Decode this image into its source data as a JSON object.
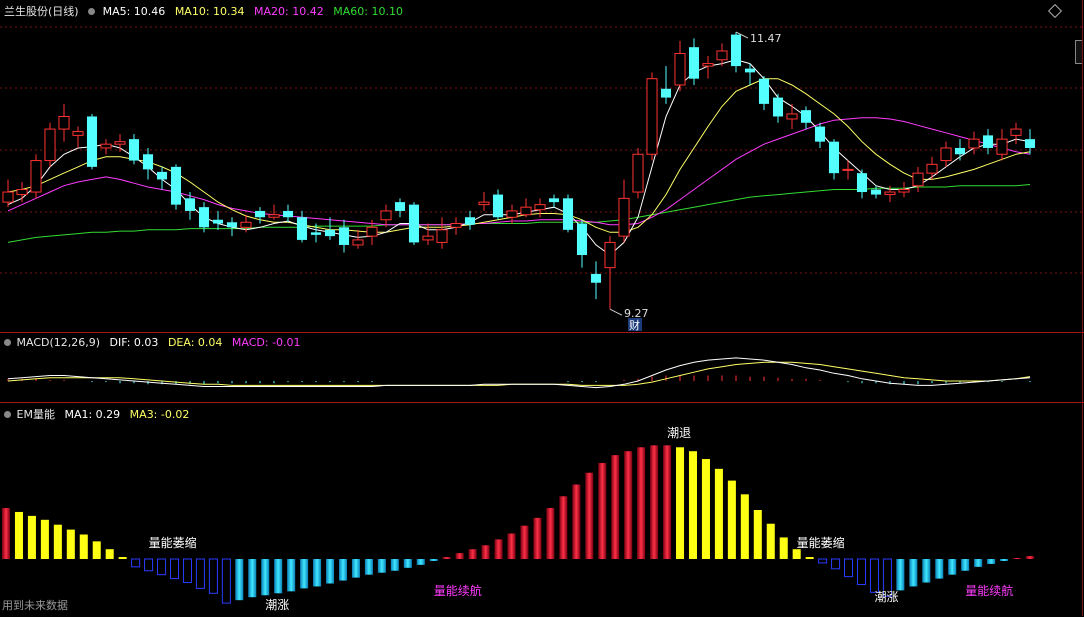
{
  "main": {
    "stock_name": "兰生股份(日线)",
    "ma5": "MA5: 10.46",
    "ma10": "MA10: 10.34",
    "ma20": "MA20: 10.42",
    "ma60": "MA60: 10.10",
    "high_label": "11.47",
    "low_label": "9.27",
    "fin_badge": "财"
  },
  "macd": {
    "title": "MACD(12,26,9)",
    "dif": "DIF: 0.03",
    "dea": "DEA: 0.04",
    "macd": "MACD: -0.01"
  },
  "em": {
    "title": "EM量能",
    "ma1": "MA1: 0.29",
    "ma3": "MA3: -0.02",
    "labels": {
      "shrink1": "量能萎缩",
      "rise1": "潮涨",
      "continue1": "量能续航",
      "retreat": "潮退",
      "shrink2": "量能萎缩",
      "rise2": "潮涨",
      "continue2": "量能续航"
    }
  },
  "footer": "用到未来数据",
  "colors": {
    "up": "#ff3232",
    "down": "#54ffff",
    "ma5": "#ffffff",
    "ma10": "#ffff66",
    "ma20": "#ff3cff",
    "ma60": "#32dc32",
    "dea": "#ffff66"
  },
  "chart_data": {
    "type": "candlestick",
    "candles": [
      [
        10.12,
        10.2,
        10.3,
        10.08
      ],
      [
        10.18,
        10.22,
        10.28,
        10.12
      ],
      [
        10.2,
        10.45,
        10.5,
        10.15
      ],
      [
        10.45,
        10.7,
        10.75,
        10.4
      ],
      [
        10.7,
        10.8,
        10.9,
        10.6
      ],
      [
        10.65,
        10.68,
        10.72,
        10.55
      ],
      [
        10.8,
        10.4,
        10.82,
        10.38
      ],
      [
        10.55,
        10.58,
        10.62,
        10.5
      ],
      [
        10.58,
        10.6,
        10.66,
        10.52
      ],
      [
        10.62,
        10.45,
        10.66,
        10.42
      ],
      [
        10.5,
        10.38,
        10.55,
        10.3
      ],
      [
        10.36,
        10.3,
        10.4,
        10.22
      ],
      [
        10.4,
        10.1,
        10.42,
        10.06
      ],
      [
        10.15,
        10.05,
        10.2,
        9.98
      ],
      [
        10.08,
        9.92,
        10.12,
        9.88
      ],
      [
        9.98,
        9.95,
        10.05,
        9.9
      ],
      [
        9.96,
        9.92,
        10.0,
        9.85
      ],
      [
        9.92,
        9.96,
        10.02,
        9.88
      ],
      [
        10.05,
        10.0,
        10.08,
        9.95
      ],
      [
        10.0,
        10.02,
        10.1,
        9.98
      ],
      [
        10.05,
        10.0,
        10.1,
        9.96
      ],
      [
        10.0,
        9.82,
        10.05,
        9.8
      ],
      [
        9.88,
        9.86,
        9.95,
        9.8
      ],
      [
        9.9,
        9.85,
        10.0,
        9.82
      ],
      [
        9.92,
        9.78,
        9.98,
        9.72
      ],
      [
        9.78,
        9.82,
        9.9,
        9.75
      ],
      [
        9.85,
        9.92,
        9.98,
        9.78
      ],
      [
        9.98,
        10.05,
        10.1,
        9.92
      ],
      [
        10.12,
        10.05,
        10.15,
        10.0
      ],
      [
        10.1,
        9.8,
        10.12,
        9.78
      ],
      [
        9.82,
        9.85,
        9.95,
        9.78
      ],
      [
        9.8,
        9.9,
        10.0,
        9.75
      ],
      [
        9.92,
        9.95,
        10.0,
        9.86
      ],
      [
        10.0,
        9.94,
        10.05,
        9.9
      ],
      [
        10.1,
        10.12,
        10.2,
        10.05
      ],
      [
        10.18,
        10.0,
        10.22,
        9.98
      ],
      [
        10.0,
        10.05,
        10.1,
        9.95
      ],
      [
        10.02,
        10.08,
        10.15,
        10.0
      ],
      [
        10.06,
        10.1,
        10.15,
        10.0
      ],
      [
        10.15,
        10.12,
        10.18,
        10.08
      ],
      [
        10.15,
        9.9,
        10.18,
        9.88
      ],
      [
        9.95,
        9.7,
        9.98,
        9.6
      ],
      [
        9.55,
        9.48,
        9.65,
        9.35
      ],
      [
        9.6,
        9.8,
        9.85,
        9.27
      ],
      [
        9.85,
        10.15,
        10.3,
        9.8
      ],
      [
        10.2,
        10.5,
        10.55,
        10.15
      ],
      [
        10.5,
        11.1,
        11.15,
        10.45
      ],
      [
        11.02,
        10.95,
        11.2,
        10.9
      ],
      [
        11.05,
        11.3,
        11.4,
        11.0
      ],
      [
        11.35,
        11.1,
        11.42,
        11.05
      ],
      [
        11.2,
        11.22,
        11.28,
        11.1
      ],
      [
        11.25,
        11.32,
        11.38,
        11.2
      ],
      [
        11.45,
        11.2,
        11.47,
        11.15
      ],
      [
        11.18,
        11.15,
        11.22,
        11.05
      ],
      [
        11.1,
        10.9,
        11.12,
        10.85
      ],
      [
        10.95,
        10.8,
        10.98,
        10.75
      ],
      [
        10.78,
        10.82,
        10.9,
        10.7
      ],
      [
        10.85,
        10.75,
        10.88,
        10.7
      ],
      [
        10.72,
        10.6,
        10.75,
        10.55
      ],
      [
        10.6,
        10.35,
        10.62,
        10.3
      ],
      [
        10.38,
        10.38,
        10.45,
        10.3
      ],
      [
        10.35,
        10.2,
        10.38,
        10.15
      ],
      [
        10.22,
        10.18,
        10.25,
        10.15
      ],
      [
        10.18,
        10.2,
        10.25,
        10.12
      ],
      [
        10.2,
        10.22,
        10.28,
        10.16
      ],
      [
        10.25,
        10.35,
        10.4,
        10.2
      ],
      [
        10.35,
        10.42,
        10.48,
        10.3
      ],
      [
        10.45,
        10.55,
        10.6,
        10.4
      ],
      [
        10.55,
        10.5,
        10.62,
        10.45
      ],
      [
        10.55,
        10.62,
        10.68,
        10.5
      ],
      [
        10.65,
        10.55,
        10.7,
        10.5
      ],
      [
        10.5,
        10.62,
        10.7,
        10.45
      ],
      [
        10.65,
        10.7,
        10.75,
        10.58
      ],
      [
        10.62,
        10.55,
        10.7,
        10.5
      ]
    ],
    "ma5": [
      10.1,
      10.15,
      10.25,
      10.4,
      10.5,
      10.55,
      10.56,
      10.58,
      10.55,
      10.48,
      10.4,
      10.3,
      10.22,
      10.1,
      10.0,
      9.95,
      9.92,
      9.9,
      9.92,
      9.95,
      9.97,
      9.93,
      9.9,
      9.88,
      9.86,
      9.84,
      9.85,
      9.88,
      9.95,
      9.95,
      9.9,
      9.9,
      9.92,
      9.96,
      10.02,
      10.02,
      10.02,
      10.04,
      10.06,
      10.08,
      10.03,
      9.92,
      9.78,
      9.7,
      9.8,
      10.0,
      10.4,
      10.8,
      11.05,
      11.15,
      11.2,
      11.22,
      11.25,
      11.22,
      11.1,
      10.95,
      10.88,
      10.8,
      10.68,
      10.55,
      10.45,
      10.35,
      10.25,
      10.22,
      10.22,
      10.25,
      10.32,
      10.4,
      10.48,
      10.55,
      10.58,
      10.58,
      10.62,
      10.6
    ],
    "ma10": [
      10.2,
      10.22,
      10.25,
      10.3,
      10.35,
      10.4,
      10.45,
      10.48,
      10.48,
      10.46,
      10.44,
      10.4,
      10.35,
      10.28,
      10.2,
      10.12,
      10.06,
      10.01,
      9.98,
      9.96,
      9.96,
      9.94,
      9.92,
      9.9,
      9.9,
      9.89,
      9.88,
      9.88,
      9.9,
      9.92,
      9.92,
      9.92,
      9.93,
      9.94,
      9.96,
      9.98,
      10.0,
      10.02,
      10.03,
      10.03,
      10.02,
      9.98,
      9.92,
      9.88,
      9.88,
      9.92,
      10.02,
      10.18,
      10.38,
      10.55,
      10.72,
      10.88,
      11.0,
      11.05,
      11.1,
      11.1,
      11.05,
      10.98,
      10.9,
      10.82,
      10.72,
      10.6,
      10.5,
      10.42,
      10.35,
      10.3,
      10.3,
      10.32,
      10.35,
      10.38,
      10.42,
      10.46,
      10.5,
      10.52
    ],
    "ma20": [
      10.05,
      10.1,
      10.15,
      10.2,
      10.25,
      10.28,
      10.3,
      10.32,
      10.3,
      10.27,
      10.24,
      10.22,
      10.2,
      10.17,
      10.14,
      10.1,
      10.07,
      10.05,
      10.03,
      10.02,
      10.01,
      10.0,
      9.99,
      9.98,
      9.97,
      9.96,
      9.95,
      9.94,
      9.94,
      9.94,
      9.94,
      9.94,
      9.94,
      9.95,
      9.95,
      9.96,
      9.97,
      9.97,
      9.98,
      9.98,
      9.98,
      9.97,
      9.96,
      9.94,
      9.94,
      9.95,
      10.0,
      10.06,
      10.14,
      10.22,
      10.3,
      10.38,
      10.46,
      10.52,
      10.58,
      10.62,
      10.66,
      10.7,
      10.74,
      10.77,
      10.78,
      10.79,
      10.79,
      10.78,
      10.76,
      10.73,
      10.7,
      10.67,
      10.64,
      10.61,
      10.58,
      10.55,
      10.52,
      10.5
    ],
    "ma60": [
      9.8,
      9.82,
      9.84,
      9.85,
      9.86,
      9.87,
      9.88,
      9.88,
      9.89,
      9.89,
      9.9,
      9.9,
      9.9,
      9.91,
      9.91,
      9.91,
      9.91,
      9.91,
      9.92,
      9.92,
      9.92,
      9.92,
      9.93,
      9.93,
      9.93,
      9.93,
      9.93,
      9.94,
      9.94,
      9.94,
      9.94,
      9.94,
      9.94,
      9.95,
      9.95,
      9.95,
      9.95,
      9.95,
      9.96,
      9.96,
      9.96,
      9.96,
      9.96,
      9.97,
      9.98,
      10.0,
      10.02,
      10.04,
      10.06,
      10.08,
      10.1,
      10.12,
      10.14,
      10.16,
      10.17,
      10.18,
      10.19,
      10.2,
      10.21,
      10.22,
      10.22,
      10.22,
      10.23,
      10.23,
      10.23,
      10.24,
      10.24,
      10.24,
      10.25,
      10.25,
      10.25,
      10.25,
      10.25,
      10.26
    ],
    "macd_hist": [
      0.02,
      0.02,
      0.02,
      0.01,
      0.01,
      0.0,
      -0.01,
      -0.01,
      -0.02,
      -0.02,
      -0.03,
      -0.03,
      -0.03,
      -0.03,
      -0.03,
      -0.02,
      -0.02,
      -0.02,
      -0.02,
      -0.02,
      -0.01,
      -0.01,
      -0.01,
      -0.01,
      -0.01,
      -0.01,
      -0.01,
      0.0,
      0.0,
      0.0,
      0.0,
      0.0,
      0.0,
      0.0,
      0.0,
      0.0,
      0.0,
      0.0,
      0.0,
      0.0,
      -0.01,
      -0.01,
      -0.01,
      0.0,
      0.01,
      0.02,
      0.04,
      0.05,
      0.05,
      0.05,
      0.05,
      0.05,
      0.05,
      0.04,
      0.04,
      0.03,
      0.02,
      0.02,
      0.01,
      0.0,
      -0.01,
      -0.02,
      -0.02,
      -0.03,
      -0.03,
      -0.03,
      -0.02,
      -0.02,
      -0.02,
      -0.01,
      -0.01,
      -0.01,
      0.0,
      -0.01
    ],
    "dif": [
      0.02,
      0.03,
      0.04,
      0.05,
      0.05,
      0.04,
      0.03,
      0.02,
      0.01,
      0.0,
      -0.01,
      -0.02,
      -0.03,
      -0.04,
      -0.05,
      -0.05,
      -0.05,
      -0.05,
      -0.05,
      -0.05,
      -0.05,
      -0.05,
      -0.05,
      -0.05,
      -0.05,
      -0.05,
      -0.05,
      -0.04,
      -0.04,
      -0.04,
      -0.04,
      -0.04,
      -0.04,
      -0.04,
      -0.03,
      -0.03,
      -0.03,
      -0.03,
      -0.03,
      -0.03,
      -0.04,
      -0.05,
      -0.06,
      -0.05,
      -0.03,
      0.0,
      0.05,
      0.1,
      0.14,
      0.17,
      0.19,
      0.2,
      0.21,
      0.2,
      0.19,
      0.17,
      0.15,
      0.12,
      0.1,
      0.07,
      0.05,
      0.02,
      0.0,
      -0.02,
      -0.03,
      -0.04,
      -0.04,
      -0.03,
      -0.02,
      -0.01,
      0.0,
      0.01,
      0.02,
      0.03
    ],
    "dea": [
      0.0,
      0.01,
      0.02,
      0.03,
      0.03,
      0.03,
      0.03,
      0.03,
      0.03,
      0.02,
      0.01,
      0.0,
      -0.01,
      -0.02,
      -0.03,
      -0.03,
      -0.04,
      -0.04,
      -0.04,
      -0.04,
      -0.04,
      -0.04,
      -0.04,
      -0.04,
      -0.04,
      -0.04,
      -0.04,
      -0.04,
      -0.04,
      -0.04,
      -0.04,
      -0.04,
      -0.04,
      -0.04,
      -0.04,
      -0.04,
      -0.03,
      -0.03,
      -0.03,
      -0.03,
      -0.03,
      -0.04,
      -0.04,
      -0.04,
      -0.04,
      -0.03,
      -0.01,
      0.02,
      0.05,
      0.08,
      0.11,
      0.13,
      0.15,
      0.16,
      0.17,
      0.17,
      0.17,
      0.16,
      0.15,
      0.13,
      0.11,
      0.09,
      0.07,
      0.05,
      0.03,
      0.02,
      0.01,
      0.0,
      0.0,
      0.0,
      0.0,
      0.01,
      0.02,
      0.04
    ],
    "em_ma1": [
      0.52,
      0.48,
      0.44,
      0.4,
      0.35,
      0.3,
      0.25,
      0.18,
      0.1,
      0.02,
      -0.08,
      -0.12,
      -0.16,
      -0.2,
      -0.24,
      -0.3,
      -0.35,
      -0.45,
      -0.42,
      -0.39,
      -0.37,
      -0.35,
      -0.33,
      -0.3,
      -0.28,
      -0.25,
      -0.22,
      -0.19,
      -0.16,
      -0.14,
      -0.12,
      -0.09,
      -0.06,
      -0.02,
      0.02,
      0.06,
      0.1,
      0.14,
      0.2,
      0.26,
      0.34,
      0.42,
      0.52,
      0.64,
      0.76,
      0.88,
      0.98,
      1.06,
      1.1,
      1.14,
      1.16,
      1.16,
      1.14,
      1.1,
      1.02,
      0.92,
      0.8,
      0.66,
      0.5,
      0.36,
      0.22,
      0.1,
      0.02,
      -0.04,
      -0.1,
      -0.18,
      -0.26,
      -0.34,
      -0.38,
      -0.32,
      -0.28,
      -0.24,
      -0.2,
      -0.16,
      -0.12,
      -0.08,
      -0.05,
      -0.02,
      0.01,
      0.03
    ],
    "em_ma3": [
      0.45,
      0.4,
      0.36,
      0.3,
      0.24,
      0.18,
      0.12,
      0.06,
      0.0,
      -0.06,
      -0.12,
      -0.16,
      -0.2,
      -0.25,
      -0.3,
      -0.36,
      -0.34,
      -0.32,
      -0.3,
      -0.28,
      -0.26,
      -0.24,
      -0.22,
      -0.2,
      -0.18,
      -0.16,
      -0.14,
      -0.12,
      -0.1,
      -0.08,
      -0.06,
      -0.03,
      0.0,
      0.03,
      0.07,
      0.11,
      0.16,
      0.22,
      0.28,
      0.36,
      0.44,
      0.54,
      0.64,
      0.74,
      0.84,
      0.92,
      0.98,
      1.02,
      1.04,
      1.04,
      1.02,
      0.98,
      0.92,
      0.84,
      0.74,
      0.62,
      0.5,
      0.38,
      0.26,
      0.14,
      0.04,
      -0.04,
      -0.12,
      -0.2,
      -0.28,
      -0.3,
      -0.28,
      -0.26,
      -0.24,
      -0.22,
      -0.2,
      -0.18,
      -0.14,
      -0.1,
      -0.06,
      -0.03,
      -0.01,
      0.0,
      0.0,
      -0.02
    ]
  }
}
